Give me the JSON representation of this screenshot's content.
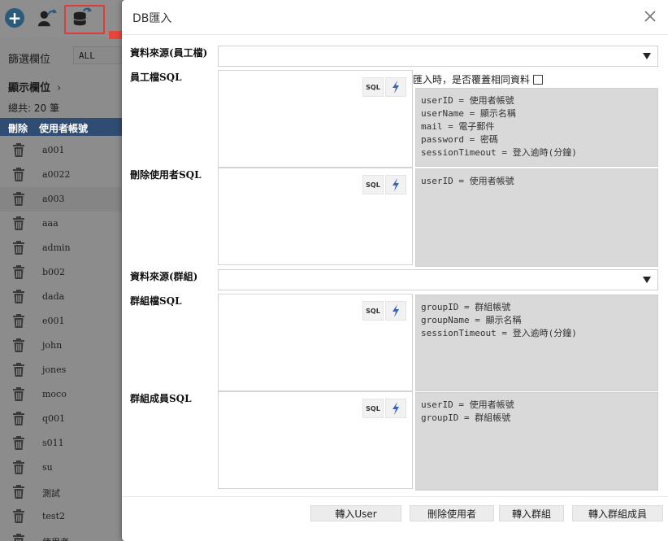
{
  "toolbar": {
    "add_icon": "plus-circle-icon",
    "user_import_icon": "user-import-icon",
    "db_import_icon": "database-import-icon",
    "add_symbol": "+"
  },
  "filter": {
    "label": "篩選欄位",
    "value": "ALL"
  },
  "display": {
    "label": "顯示欄位",
    "chevron": "›"
  },
  "total": "總共: 20 筆",
  "list": {
    "headers": {
      "delete": "刪除",
      "account": "使用者帳號"
    },
    "accounts": [
      "a001",
      "a0022",
      "a003",
      "aaa",
      "admin",
      "b002",
      "dada",
      "e001",
      "john",
      "jones",
      "moco",
      "q001",
      "s011",
      "su",
      "測試",
      "test2",
      "使用者"
    ]
  },
  "dialog": {
    "title": "DB匯入",
    "fields": {
      "employee_source": "資料來源(員工檔)",
      "employee_sql": "員工檔SQL",
      "delete_user_sql": "刪除使用者SQL",
      "group_source": "資料來源(群組)",
      "group_sql": "群組檔SQL",
      "group_member_sql": "群組成員SQL"
    },
    "overwrite_label": "匯入時，是否覆蓋相同資料",
    "sql_button": "SQL",
    "hints": {
      "employee": "userID = 使用者帳號\nuserName = 顯示名稱\nmail = 電子郵件\npassword = 密碼\nsessionTimeout = 登入逾時(分鐘)",
      "delete_user": "userID = 使用者帳號",
      "group": "groupID = 群組帳號\ngroupName = 顯示名稱\nsessionTimeout = 登入逾時(分鐘)",
      "group_member": "userID = 使用者帳號\ngroupID = 群組帳號"
    },
    "buttons": {
      "import_user": "轉入User",
      "delete_user": "刪除使用者",
      "import_group": "轉入群組",
      "import_group_member": "轉入群組成員"
    }
  },
  "colors": {
    "list_header": "#2f4d72",
    "highlight_box": "#e03a3a",
    "arrow": "#e8463c",
    "hint_bg": "#d9d9d9",
    "lightning": "#3a63b8"
  }
}
